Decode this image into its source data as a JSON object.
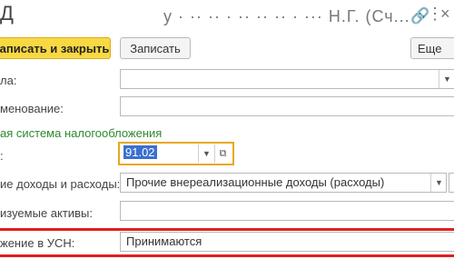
{
  "header": {
    "title": "Д",
    "title_tail": "у · ·· ·· · ·· ·· ·· · ··· Н.Г. (Сч...",
    "link_icon": "link-icon",
    "more_icon": "more-icon",
    "close_icon": "close-icon"
  },
  "toolbar": {
    "save_close_label": "аписать и закрыть",
    "save_label": "Записать",
    "more_label": "Еще"
  },
  "form": {
    "row1_label": "ла:",
    "row1_value": "",
    "row2_label": "менование:",
    "row2_value": "",
    "section_title": "ая система налогообложения",
    "account_label": ":",
    "account_value": "91.02",
    "income_label": "ие доходы и расходы:",
    "income_value": "Прочие внереализационные доходы (расходы)",
    "assets_label": "изуемые активы:",
    "assets_value": "",
    "usn_label": "жение в УСН:",
    "usn_value": "Принимаются"
  },
  "colors": {
    "accent_button": "#f8d843",
    "highlight_border": "#e8a81b",
    "section_text": "#2d8a2d",
    "red_underline": "#e0201b"
  }
}
